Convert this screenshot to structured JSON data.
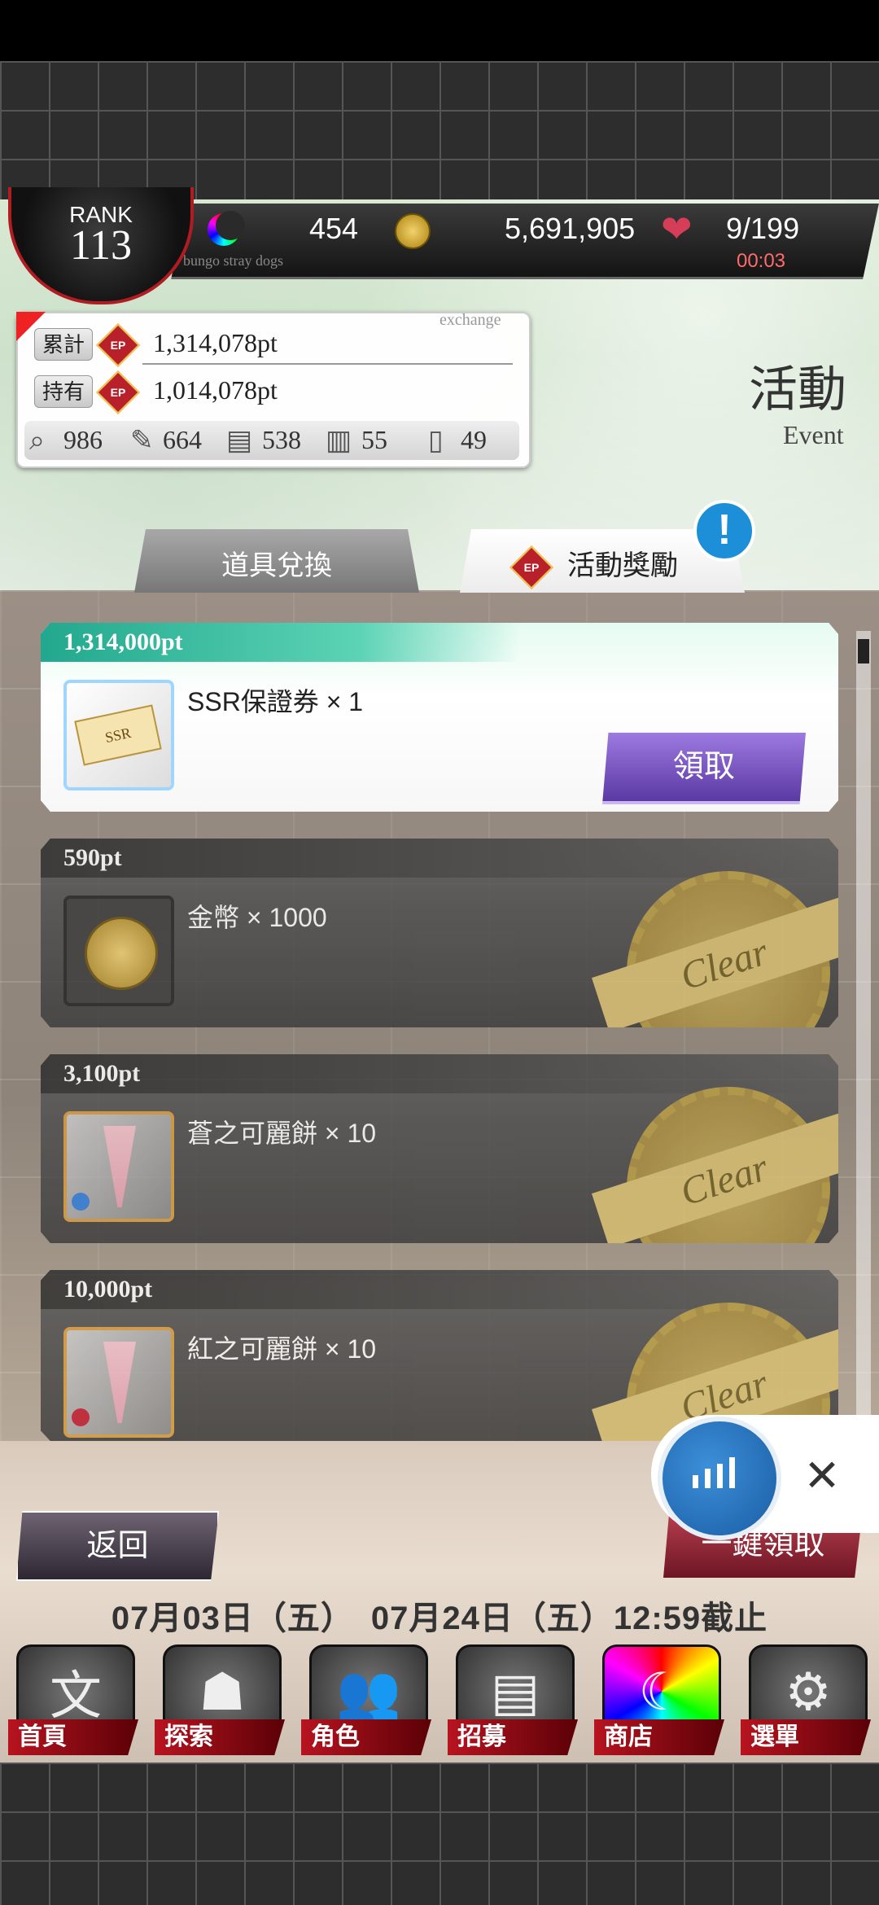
{
  "header": {
    "rank_label": "RANK",
    "rank_value": "113",
    "moon_value": "454",
    "coins": "5,691,905",
    "stamina": "9/199",
    "timer": "00:03",
    "subtitle": "bungo stray dogs"
  },
  "points": {
    "exchange_label": "exchange",
    "total_label": "累計",
    "total_value": "1,314,078pt",
    "held_label": "持有",
    "held_value": "1,014,078pt",
    "ep_badge": "EP",
    "items": [
      {
        "icon": "magnifier-icon",
        "value": "986"
      },
      {
        "icon": "brush-icon",
        "value": "664"
      },
      {
        "icon": "book-icon",
        "value": "538"
      },
      {
        "icon": "scroll-icon",
        "value": "55"
      },
      {
        "icon": "milk-icon",
        "value": "49"
      }
    ]
  },
  "page_title": {
    "zh": "活動",
    "en": "Event"
  },
  "tabs": {
    "items_exchange": "道具兌換",
    "event_rewards": "活動獎勵",
    "alert": "!"
  },
  "rewards": [
    {
      "points": "1,314,000pt",
      "name": "SSR保證券 × 1",
      "state": "claimable",
      "thumb": "ssr-ticket-icon",
      "button": "領取"
    },
    {
      "points": "590pt",
      "name": "金幣 × 1000",
      "state": "cleared",
      "thumb": "gold-coin-icon",
      "stamp": "Clear"
    },
    {
      "points": "3,100pt",
      "name": "蒼之可麗餅 × 10",
      "state": "cleared",
      "thumb": "blue-crepe-icon",
      "stamp": "Clear"
    },
    {
      "points": "10,000pt",
      "name": "紅之可麗餅 × 10",
      "state": "cleared",
      "thumb": "red-crepe-icon",
      "stamp": "Clear"
    }
  ],
  "footer": {
    "back": "返回",
    "claim_all": "一鍵領取",
    "period": "07月03日（五）　07月24日（五）12:59截止"
  },
  "nav": [
    {
      "label": "首頁",
      "icon": "home-icon"
    },
    {
      "label": "探索",
      "icon": "explore-icon"
    },
    {
      "label": "角色",
      "icon": "characters-icon"
    },
    {
      "label": "招募",
      "icon": "recruit-icon"
    },
    {
      "label": "商店",
      "icon": "shop-icon"
    },
    {
      "label": "選單",
      "icon": "menu-icon"
    }
  ],
  "colors": {
    "accent_red": "#b11b22",
    "claim_purple": "#5b39a3",
    "active_header_teal": "#22a88e",
    "alert_blue": "#1d8fd9"
  }
}
